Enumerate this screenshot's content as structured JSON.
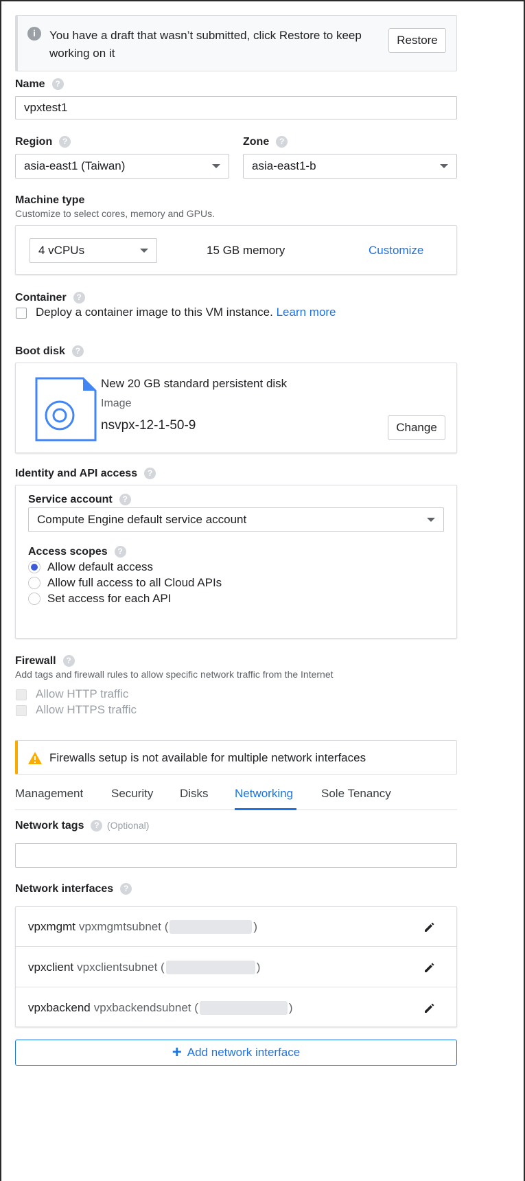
{
  "draft_banner": {
    "message": "You have a draft that wasn’t submitted, click Restore to keep working on it",
    "restore_label": "Restore",
    "icon": "info-icon"
  },
  "name": {
    "label": "Name",
    "value": "vpxtest1"
  },
  "region": {
    "label": "Region",
    "value": "asia-east1 (Taiwan)"
  },
  "zone": {
    "label": "Zone",
    "value": "asia-east1-b"
  },
  "machine_type": {
    "label": "Machine type",
    "description": "Customize to select cores, memory and GPUs.",
    "cores": "4 vCPUs",
    "memory": "15 GB memory",
    "customize_label": "Customize"
  },
  "container": {
    "label": "Container",
    "checkbox_text": "Deploy a container image to this VM instance.",
    "learn_more": "Learn more"
  },
  "boot_disk": {
    "label": "Boot disk",
    "title": "New 20 GB standard persistent disk",
    "image_label": "Image",
    "image_value": "nsvpx-12-1-50-9",
    "change_label": "Change",
    "icon": "disk-icon"
  },
  "identity": {
    "label": "Identity and API access",
    "service_account_label": "Service account",
    "service_account_value": "Compute Engine default service account",
    "access_scopes_label": "Access scopes",
    "scopes": [
      {
        "label": "Allow default access",
        "selected": true
      },
      {
        "label": "Allow full access to all Cloud APIs",
        "selected": false
      },
      {
        "label": "Set access for each API",
        "selected": false
      }
    ]
  },
  "firewall": {
    "label": "Firewall",
    "description": "Add tags and firewall rules to allow specific network traffic from the Internet",
    "http_label": "Allow HTTP traffic",
    "https_label": "Allow HTTPS traffic"
  },
  "warning": {
    "message": "Firewalls setup is not available for multiple network interfaces",
    "icon": "warning-icon",
    "color": "#f9ab00"
  },
  "tabs": [
    {
      "label": "Management",
      "active": false
    },
    {
      "label": "Security",
      "active": false
    },
    {
      "label": "Disks",
      "active": false
    },
    {
      "label": "Networking",
      "active": true
    },
    {
      "label": "Sole Tenancy",
      "active": false
    }
  ],
  "network_tags": {
    "label": "Network tags",
    "optional": "(Optional)",
    "value": ""
  },
  "network_interfaces": {
    "label": "Network interfaces",
    "items": [
      {
        "name": "vpxmgmt",
        "subnet": "vpxmgmtsubnet (",
        "close": ")"
      },
      {
        "name": "vpxclient",
        "subnet": "vpxclientsubnet (",
        "close": ")"
      },
      {
        "name": "vpxbackend",
        "subnet": "vpxbackendsubnet (",
        "close": ")"
      }
    ],
    "add_label": "Add network interface"
  },
  "colors": {
    "accent": "#1a73e8",
    "radio": "#3b5bdb"
  }
}
